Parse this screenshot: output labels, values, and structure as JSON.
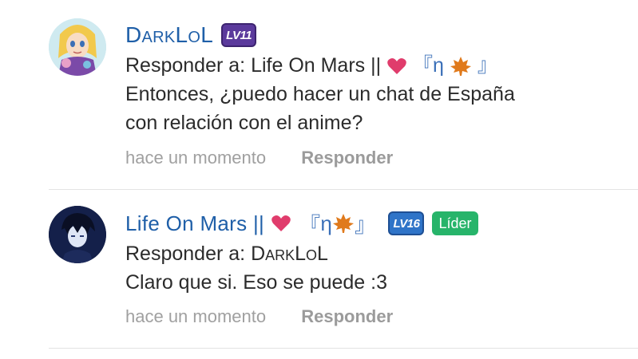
{
  "comments": [
    {
      "username": "DarkLoL",
      "level": "LV11",
      "reply_prefix": "Responder a:",
      "reply_to": "Life On Mars ||",
      "reply_suffix_open": "『",
      "reply_suffix_eta": "η",
      "reply_suffix_close": "』",
      "body_lines": [
        "Entonces, ¿puedo hacer un chat de España",
        "con relación con el anime?"
      ],
      "time": "hace un momento",
      "reply_label": "Responder"
    },
    {
      "username": "Life On Mars ||",
      "username_open": "『",
      "username_eta": "η",
      "username_close": "』",
      "level": "LV16",
      "role_badge": "Líder",
      "reply_prefix": "Responder a:",
      "reply_to": "DarkLoL",
      "body_lines": [
        "Claro que si. Eso se puede :3"
      ],
      "time": "hace un momento",
      "reply_label": "Responder"
    }
  ],
  "colors": {
    "username": "#1f5fa8",
    "heart": "#e03c6c",
    "leaf": "#e07a1c",
    "leader_badge": "#27b46a",
    "level_purple": "#5b3a9c",
    "level_blue": "#2f74c8",
    "meta": "#9a9a9a"
  },
  "icons": [
    "avatar-anime-girl",
    "avatar-dark-hair-boy",
    "heart-icon",
    "maple-leaf-icon"
  ]
}
